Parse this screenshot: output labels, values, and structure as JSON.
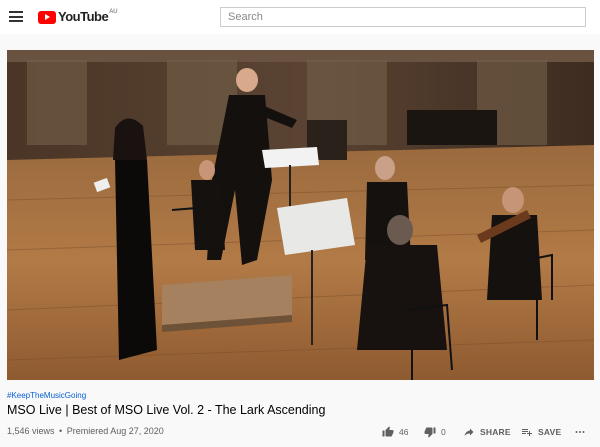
{
  "header": {
    "logo_text": "YouTube",
    "logo_region": "AU",
    "search_placeholder": "Search"
  },
  "video": {
    "hashtag": "#KeepTheMusicGoing",
    "title": "MSO Live | Best of MSO Live Vol. 2 - The Lark Ascending",
    "views": "1,546 views",
    "separator": "•",
    "premiered": "Premiered Aug 27, 2020"
  },
  "actions": {
    "like_count": "46",
    "dislike_count": "0",
    "share_label": "SHARE",
    "save_label": "SAVE"
  },
  "icons": {
    "menu": "hamburger-menu-icon",
    "like": "thumbs-up-icon",
    "dislike": "thumbs-down-icon",
    "share": "share-arrow-icon",
    "save": "add-to-playlist-icon",
    "more": "more-horizontal-icon"
  },
  "colors": {
    "brand_red": "#ff0000",
    "link_blue": "#065fd4",
    "secondary_text": "#606060"
  }
}
